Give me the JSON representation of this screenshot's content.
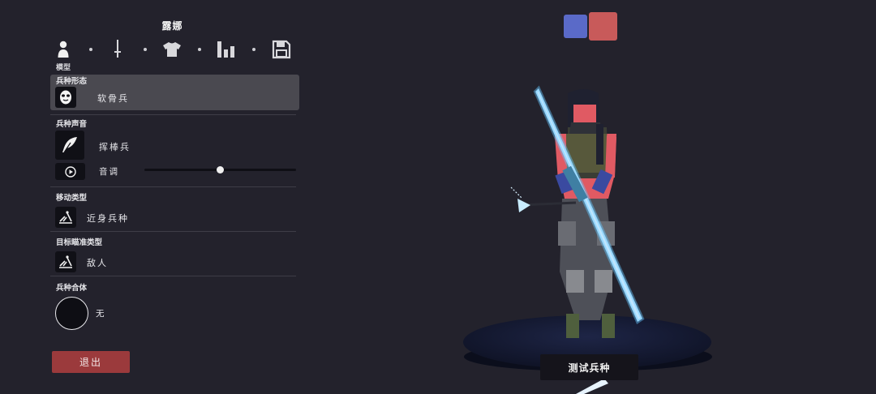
{
  "unit_name": "露娜",
  "tabs": [
    {
      "icon": "person-icon",
      "label": "模型",
      "active": true
    },
    {
      "icon": "sword-icon",
      "label": "",
      "active": false
    },
    {
      "icon": "shirt-icon",
      "label": "",
      "active": false
    },
    {
      "icon": "stats-icon",
      "label": "",
      "active": false
    },
    {
      "icon": "save-icon",
      "label": "",
      "active": false
    }
  ],
  "active_tab_label": "模型",
  "sections": {
    "form": {
      "label": "兵种形态",
      "value": "软骨兵",
      "icon": "mask-icon"
    },
    "voice": {
      "label": "兵种声音",
      "value": "挥棒兵",
      "icon": "feather-icon",
      "pitch_label": "音调",
      "pitch_value": 0.5
    },
    "movement": {
      "label": "移动类型",
      "value": "近身兵种",
      "icon": "melee-icon"
    },
    "targeting": {
      "label": "目标瞄准类型",
      "value": "敌人",
      "icon": "melee-icon"
    },
    "merge": {
      "label": "兵种合体",
      "value": "无"
    }
  },
  "exit_label": "退出",
  "test_label": "测试兵种",
  "team_colors": {
    "blue": "#5a6ac8",
    "red": "#c85a5a"
  },
  "accent": "#9b3a3c"
}
